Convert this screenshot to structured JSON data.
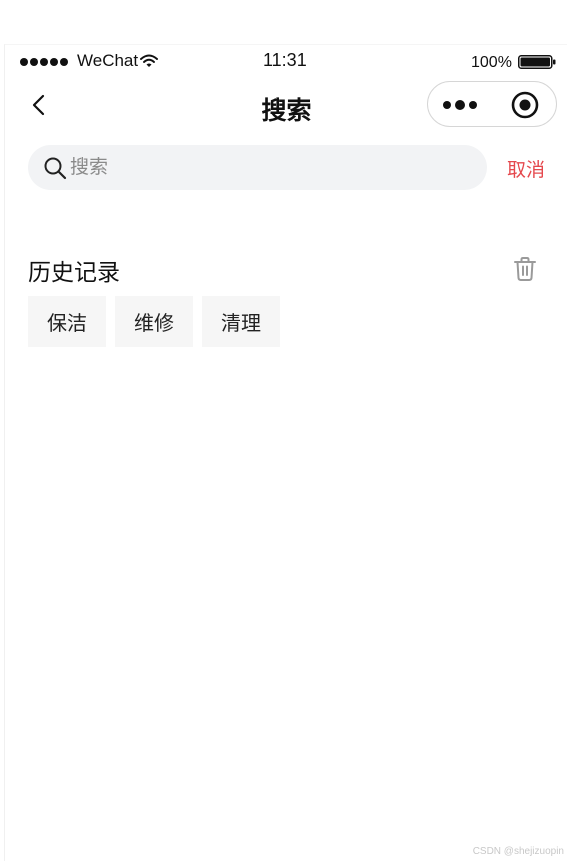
{
  "status_bar": {
    "carrier": "WeChat",
    "time": "11:31",
    "battery": "100%"
  },
  "nav": {
    "title": "搜索"
  },
  "search": {
    "placeholder": "搜索",
    "value": "",
    "cancel_label": "取消"
  },
  "history": {
    "title": "历史记录",
    "tags": [
      "保洁",
      "维修",
      "清理"
    ]
  },
  "watermark": "CSDN @shejizuopin",
  "colors": {
    "accent_cancel": "#e5484d",
    "search_bg": "#f2f3f5",
    "tag_bg": "#f6f6f6"
  }
}
